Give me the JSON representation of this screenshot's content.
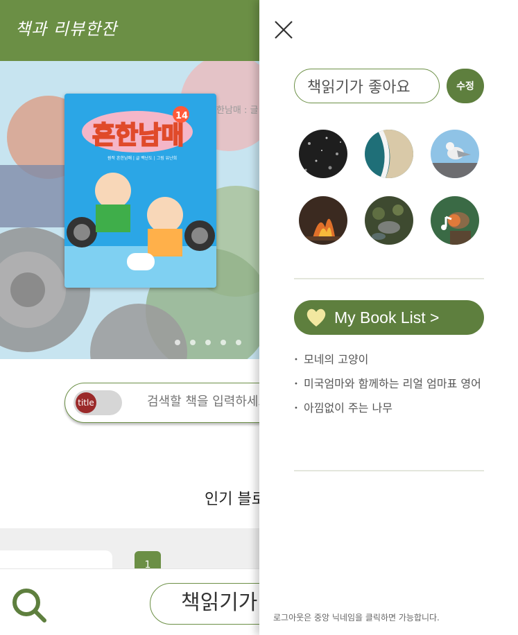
{
  "header": {
    "logo": "책과 리뷰한잔"
  },
  "banner": {
    "caption": "한남매 : 글",
    "cover": {
      "title": "흔한남매",
      "volume": "14",
      "credit": "원작 흔한남매 | 글 백난도 | 그림 유난희"
    },
    "slide_count": 5
  },
  "search": {
    "toggle_label": "title",
    "placeholder": "검색할 책을 입력하세요"
  },
  "main": {
    "section_title": "인기 블로그",
    "rank_badge": "1"
  },
  "bottom_bar": {
    "nickname": "책읽기가 좋아요"
  },
  "drawer": {
    "nickname_value": "책읽기가 좋아요",
    "edit_label": "수정",
    "themes": [
      {
        "name": "dark-texture"
      },
      {
        "name": "ocean-wave"
      },
      {
        "name": "seagull"
      },
      {
        "name": "campfire"
      },
      {
        "name": "forest-stream"
      },
      {
        "name": "robin-bird"
      }
    ],
    "mybook_label": "My Book List >",
    "books": [
      "모네의 고양이",
      "미국엄마와 함께하는 리얼 엄마표 영어",
      "아낌없이 주는 나무"
    ],
    "logout_note": "로그아웃은 중앙 닉네임을 클릭하면 가능합니다."
  },
  "colors": {
    "brand_green": "#6b8f45",
    "button_green": "#5e7f3e",
    "toggle_red": "#9b2a2a",
    "heart_yellow": "#f2e8a0"
  }
}
